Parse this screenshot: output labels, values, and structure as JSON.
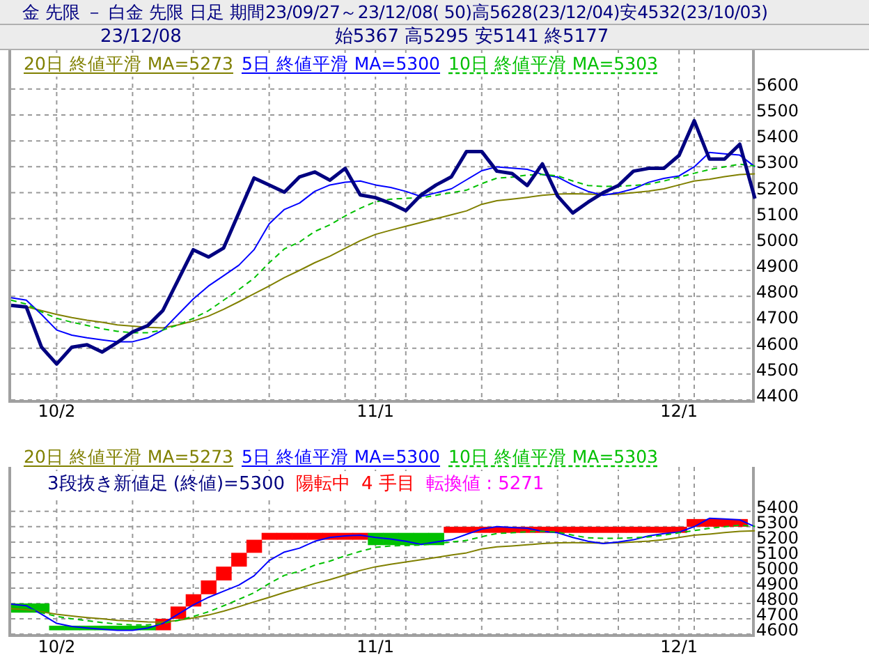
{
  "header": {
    "title": "金 先限 － 白金 先限 日足 期間23/09/27～23/12/08( 50)高5628(23/12/04)安4532(23/10/03)",
    "date": "23/12/08",
    "ohlc": "始5367 高5295 安5141 終5177"
  },
  "price_chart": {
    "legend": [
      {
        "label": "20日 終値平滑 MA=5273",
        "color": "#808000",
        "kind": "solid"
      },
      {
        "label": "5日 終値平滑 MA=5300",
        "color": "#0000ff",
        "kind": "solid"
      },
      {
        "label": "10日 終値平滑 MA=5303",
        "color": "#00c000",
        "kind": "dashed"
      }
    ],
    "chart_data": {
      "type": "line",
      "grid": true,
      "ylim": [
        4400,
        5750
      ],
      "yticks": [
        4400,
        4500,
        4600,
        4700,
        4800,
        4900,
        5000,
        5100,
        5200,
        5300,
        5400,
        5500,
        5600
      ],
      "categories": [
        null,
        null,
        null,
        "10/2",
        null,
        null,
        null,
        null,
        null,
        null,
        null,
        null,
        null,
        null,
        null,
        null,
        null,
        null,
        null,
        null,
        null,
        null,
        null,
        null,
        "11/1",
        null,
        null,
        null,
        null,
        null,
        null,
        null,
        null,
        null,
        null,
        null,
        null,
        null,
        null,
        null,
        null,
        null,
        null,
        null,
        "12/1",
        null,
        null,
        null,
        null,
        null
      ],
      "series": [
        {
          "color": "#000080",
          "line_style": "solid",
          "values": [
            4765,
            4759,
            4604,
            4539,
            4604,
            4613,
            4585,
            4622,
            4663,
            4687,
            4746,
            4863,
            4980,
            4952,
            4987,
            5122,
            5257,
            5230,
            5202,
            5261,
            5280,
            5248,
            5294,
            5191,
            5181,
            5159,
            5131,
            5191,
            5230,
            5261,
            5359,
            5359,
            5283,
            5274,
            5228,
            5311,
            5187,
            5122,
            5163,
            5200,
            5228,
            5283,
            5294,
            5294,
            5344,
            5478,
            5330,
            5330,
            5387,
            5177
          ]
        },
        {
          "color": "#808000",
          "line_style": "solid",
          "values": [
            4765,
            4760,
            4745,
            4730,
            4718,
            4708,
            4700,
            4690,
            4685,
            4680,
            4678,
            4690,
            4705,
            4724,
            4750,
            4779,
            4810,
            4840,
            4872,
            4900,
            4930,
            4955,
            4985,
            5015,
            5039,
            5055,
            5070,
            5085,
            5100,
            5115,
            5130,
            5155,
            5169,
            5175,
            5182,
            5190,
            5195,
            5196,
            5195,
            5193,
            5195,
            5200,
            5206,
            5215,
            5230,
            5245,
            5252,
            5262,
            5270,
            5273
          ]
        },
        {
          "color": "#0000ff",
          "line_style": "solid",
          "values": [
            4795,
            4785,
            4730,
            4670,
            4650,
            4640,
            4632,
            4625,
            4625,
            4640,
            4670,
            4730,
            4790,
            4840,
            4880,
            4920,
            4980,
            5080,
            5135,
            5160,
            5205,
            5230,
            5240,
            5245,
            5230,
            5220,
            5205,
            5185,
            5200,
            5215,
            5250,
            5285,
            5300,
            5295,
            5290,
            5270,
            5260,
            5230,
            5205,
            5190,
            5200,
            5215,
            5240,
            5255,
            5265,
            5300,
            5355,
            5350,
            5345,
            5300
          ]
        },
        {
          "color": "#00c000",
          "line_style": "dashed",
          "values": [
            4785,
            4770,
            4740,
            4715,
            4700,
            4688,
            4675,
            4665,
            4660,
            4660,
            4670,
            4690,
            4715,
            4745,
            4785,
            4826,
            4870,
            4930,
            4983,
            5010,
            5050,
            5076,
            5110,
            5140,
            5165,
            5175,
            5178,
            5180,
            5190,
            5200,
            5210,
            5235,
            5256,
            5260,
            5268,
            5270,
            5265,
            5245,
            5228,
            5224,
            5225,
            5228,
            5233,
            5245,
            5260,
            5275,
            5289,
            5300,
            5310,
            5303
          ]
        }
      ]
    }
  },
  "break_chart": {
    "legend": [
      {
        "label": "20日 終値平滑 MA=5273",
        "color": "#808000",
        "kind": "solid"
      },
      {
        "label": "5日 終値平滑 MA=5300",
        "color": "#0000ff",
        "kind": "solid"
      },
      {
        "label": "10日 終値平滑 MA=5303",
        "color": "#00c000",
        "kind": "dashed"
      }
    ],
    "status": [
      {
        "text": "3段抜き新値足 (終値)=5300",
        "color": "#000080"
      },
      {
        "text": "陽転中",
        "color": "#ff0000"
      },
      {
        "text": "4 手目",
        "color": "#ff0000"
      },
      {
        "text": "転換値 : 5271",
        "color": "#ff00ff"
      }
    ],
    "chart_data": {
      "type": "line",
      "grid": true,
      "ylim": [
        4600,
        5690
      ],
      "yticks": [
        4600,
        4700,
        4800,
        4900,
        5000,
        5100,
        5200,
        5300,
        5400
      ],
      "categories": [
        null,
        null,
        null,
        "10/2",
        null,
        null,
        null,
        null,
        null,
        null,
        null,
        null,
        null,
        null,
        null,
        null,
        null,
        null,
        null,
        null,
        null,
        null,
        null,
        null,
        "11/1",
        null,
        null,
        null,
        null,
        null,
        null,
        null,
        null,
        null,
        null,
        null,
        null,
        null,
        null,
        null,
        null,
        null,
        null,
        null,
        "12/1",
        null,
        null,
        null,
        null,
        null
      ],
      "series": [
        {
          "color": "#ff0000",
          "type": "candlestick",
          "ohlc": [
            null,
            null,
            null,
            null,
            null,
            null,
            null,
            null,
            null,
            null,
            [
              4625,
              4700,
              4625,
              4700
            ],
            [
              4700,
              4780,
              4700,
              4780
            ],
            [
              4780,
              4860,
              4780,
              4860
            ],
            [
              4860,
              4950,
              4860,
              4950
            ],
            [
              4950,
              5040,
              4950,
              5040
            ],
            [
              5040,
              5130,
              5040,
              5130
            ],
            [
              5130,
              5215,
              5130,
              5215
            ],
            [
              5215,
              5260,
              5215,
              5260
            ],
            [
              5215,
              5260,
              5215,
              5260
            ],
            [
              5215,
              5260,
              5215,
              5260
            ],
            [
              5215,
              5260,
              5215,
              5260
            ],
            [
              5215,
              5260,
              5215,
              5260
            ],
            [
              5215,
              5260,
              5215,
              5260
            ],
            [
              5215,
              5260,
              5215,
              5260
            ],
            null,
            null,
            null,
            null,
            null,
            [
              5260,
              5300,
              5260,
              5300
            ],
            [
              5260,
              5300,
              5260,
              5300
            ],
            [
              5260,
              5300,
              5260,
              5300
            ],
            [
              5260,
              5300,
              5260,
              5300
            ],
            [
              5260,
              5300,
              5260,
              5300
            ],
            [
              5260,
              5300,
              5260,
              5300
            ],
            [
              5260,
              5300,
              5260,
              5300
            ],
            [
              5260,
              5300,
              5260,
              5300
            ],
            [
              5260,
              5300,
              5260,
              5300
            ],
            [
              5260,
              5300,
              5260,
              5300
            ],
            [
              5260,
              5300,
              5260,
              5300
            ],
            [
              5260,
              5300,
              5260,
              5300
            ],
            [
              5260,
              5300,
              5260,
              5300
            ],
            [
              5260,
              5300,
              5260,
              5300
            ],
            [
              5260,
              5300,
              5260,
              5300
            ],
            [
              5260,
              5300,
              5260,
              5300
            ],
            [
              5300,
              5350,
              5300,
              5350
            ],
            [
              5300,
              5350,
              5300,
              5350
            ],
            [
              5300,
              5350,
              5300,
              5350
            ],
            [
              5300,
              5350,
              5300,
              5350
            ],
            null
          ]
        },
        {
          "color": "#00c000",
          "type": "candlestick",
          "ohlc": [
            [
              4800,
              4800,
              4740,
              4740
            ],
            [
              4800,
              4800,
              4740,
              4740
            ],
            [
              4800,
              4800,
              4740,
              4740
            ],
            [
              4655,
              4655,
              4625,
              4625
            ],
            [
              4655,
              4655,
              4625,
              4625
            ],
            [
              4655,
              4655,
              4625,
              4625
            ],
            [
              4655,
              4655,
              4625,
              4625
            ],
            [
              4655,
              4655,
              4625,
              4625
            ],
            [
              4655,
              4655,
              4625,
              4625
            ],
            [
              4655,
              4655,
              4625,
              4625
            ],
            null,
            null,
            null,
            null,
            null,
            null,
            null,
            null,
            null,
            null,
            null,
            null,
            null,
            null,
            [
              5260,
              5260,
              5180,
              5180
            ],
            [
              5260,
              5260,
              5180,
              5180
            ],
            [
              5260,
              5260,
              5180,
              5180
            ],
            [
              5260,
              5260,
              5180,
              5180
            ],
            [
              5260,
              5260,
              5180,
              5180
            ],
            null,
            null,
            null,
            null,
            null,
            null,
            null,
            null,
            null,
            null,
            null,
            null,
            null,
            null,
            null,
            null,
            null,
            null,
            null,
            null,
            null
          ]
        },
        {
          "color": "#808000",
          "line_style": "solid",
          "values": [
            4765,
            4760,
            4745,
            4730,
            4718,
            4708,
            4700,
            4690,
            4685,
            4680,
            4678,
            4690,
            4705,
            4724,
            4750,
            4779,
            4810,
            4840,
            4872,
            4900,
            4930,
            4955,
            4985,
            5015,
            5039,
            5055,
            5070,
            5085,
            5100,
            5115,
            5130,
            5155,
            5169,
            5175,
            5182,
            5190,
            5195,
            5196,
            5195,
            5193,
            5195,
            5200,
            5206,
            5215,
            5230,
            5245,
            5252,
            5262,
            5270,
            5273
          ]
        },
        {
          "color": "#0000ff",
          "line_style": "solid",
          "values": [
            4795,
            4785,
            4730,
            4670,
            4650,
            4640,
            4632,
            4625,
            4625,
            4640,
            4670,
            4730,
            4790,
            4840,
            4880,
            4920,
            4980,
            5080,
            5135,
            5160,
            5205,
            5230,
            5240,
            5245,
            5230,
            5220,
            5205,
            5185,
            5200,
            5215,
            5250,
            5285,
            5300,
            5295,
            5290,
            5270,
            5260,
            5230,
            5205,
            5190,
            5200,
            5215,
            5240,
            5255,
            5265,
            5300,
            5355,
            5350,
            5345,
            5300
          ]
        },
        {
          "color": "#00c000",
          "line_style": "dashed",
          "values": [
            4785,
            4770,
            4740,
            4715,
            4700,
            4688,
            4675,
            4665,
            4660,
            4660,
            4670,
            4690,
            4715,
            4745,
            4785,
            4826,
            4870,
            4930,
            4983,
            5010,
            5050,
            5076,
            5110,
            5140,
            5165,
            5175,
            5178,
            5180,
            5190,
            5200,
            5210,
            5235,
            5256,
            5260,
            5268,
            5270,
            5265,
            5245,
            5228,
            5224,
            5225,
            5228,
            5233,
            5245,
            5260,
            5275,
            5289,
            5300,
            5310,
            5303
          ]
        }
      ]
    }
  }
}
